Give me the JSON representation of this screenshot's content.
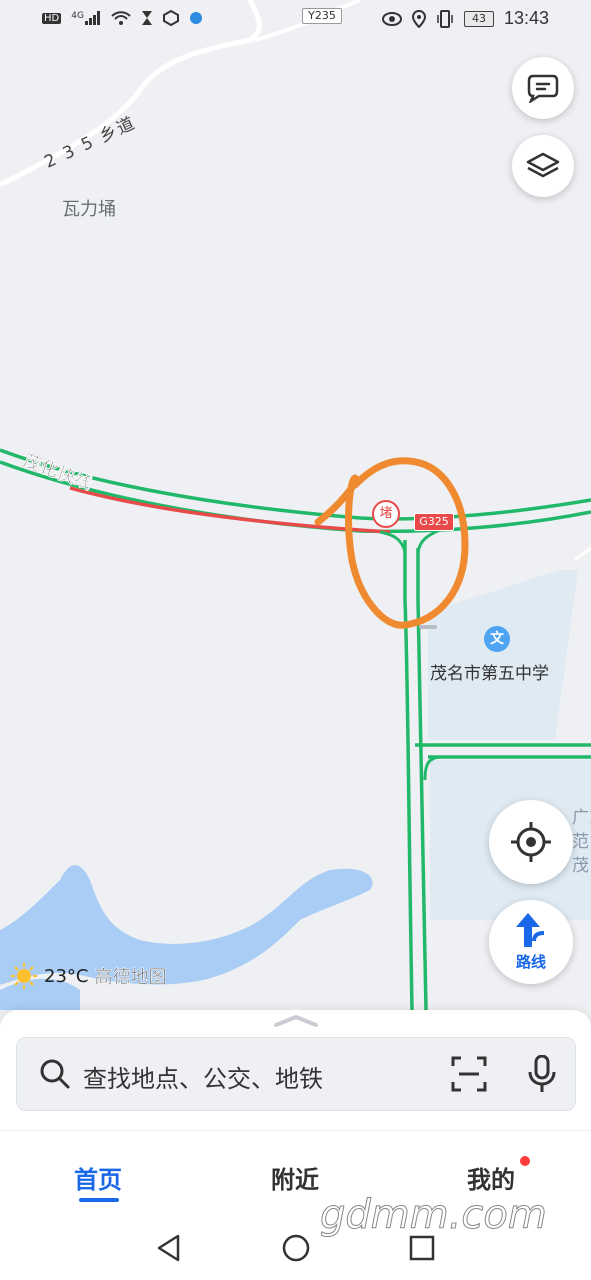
{
  "status_bar": {
    "left_icons": [
      "hd-icon",
      "signal-4g-icon",
      "wifi-icon",
      "hourglass-icon",
      "app-notification-icon",
      "app-notification-icon-2"
    ],
    "network": "4G",
    "hd": "HD",
    "battery": "43",
    "time": "13:43"
  },
  "map": {
    "top_road_badge": "Y235",
    "township_road": "2 3 5 乡道",
    "village": "瓦力埇",
    "expressway": "茂化快线",
    "congestion_marker": "堵",
    "highway_badge": "G325",
    "school_icon_char": "文",
    "school": "茂名市第五中学",
    "partial_label": "广东\n范\n茂",
    "annotation_color": "#f08a30",
    "traffic_colors": {
      "smooth": "#22b86a",
      "jam": "#e84a4a"
    }
  },
  "weather": {
    "temperature": "23°C",
    "brand": "高德地图"
  },
  "controls": {
    "route_label": "路线"
  },
  "search": {
    "placeholder": "查找地点、公交、地铁"
  },
  "tabs": [
    {
      "label": "首页",
      "active": true
    },
    {
      "label": "附近",
      "active": false
    },
    {
      "label": "我的",
      "active": false,
      "badge": true
    }
  ],
  "watermark": "gdmm.com",
  "accent_color": "#1a68e8"
}
